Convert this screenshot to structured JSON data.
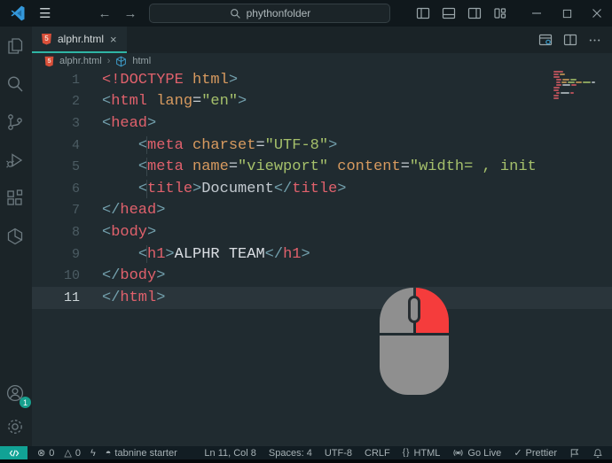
{
  "titlebar": {
    "search_value": "phythonfolder",
    "menu_glyph": "☰",
    "back_glyph": "←",
    "forward_glyph": "→"
  },
  "tab": {
    "label": "alphr.html",
    "close_glyph": "×",
    "file_icon_text": "5"
  },
  "breadcrumb": {
    "file": "alphr.html",
    "separator": "›",
    "symbol": "html"
  },
  "activitybar": {
    "top": [
      "explorer",
      "search",
      "source-control",
      "run-debug",
      "extensions",
      "package"
    ],
    "bottom": [
      "account",
      "settings-gear"
    ],
    "account_badge": "1"
  },
  "editor": {
    "active_line": 11,
    "lines": [
      {
        "num": "1",
        "indent": false,
        "tokens": [
          {
            "t": "<!DOCTYPE",
            "c": "tag"
          },
          {
            "t": " html",
            "c": "attr"
          },
          {
            "t": ">",
            "c": "punct"
          }
        ]
      },
      {
        "num": "2",
        "indent": false,
        "tokens": [
          {
            "t": "<",
            "c": "punct"
          },
          {
            "t": "html",
            "c": "tag"
          },
          {
            "t": " ",
            "c": "plain"
          },
          {
            "t": "lang",
            "c": "attr"
          },
          {
            "t": "=",
            "c": "plain"
          },
          {
            "t": "\"en\"",
            "c": "str"
          },
          {
            "t": ">",
            "c": "punct"
          }
        ]
      },
      {
        "num": "3",
        "indent": false,
        "tokens": [
          {
            "t": "<",
            "c": "punct"
          },
          {
            "t": "head",
            "c": "tag"
          },
          {
            "t": ">",
            "c": "punct"
          }
        ]
      },
      {
        "num": "4",
        "indent": true,
        "tokens": [
          {
            "t": "    ",
            "c": "plain"
          },
          {
            "t": "<",
            "c": "punct"
          },
          {
            "t": "meta",
            "c": "tag"
          },
          {
            "t": " charset",
            "c": "attr"
          },
          {
            "t": "=",
            "c": "plain"
          },
          {
            "t": "\"UTF-8\"",
            "c": "str"
          },
          {
            "t": ">",
            "c": "punct"
          }
        ]
      },
      {
        "num": "5",
        "indent": true,
        "tokens": [
          {
            "t": "    ",
            "c": "plain"
          },
          {
            "t": "<",
            "c": "punct"
          },
          {
            "t": "meta",
            "c": "tag"
          },
          {
            "t": " name",
            "c": "attr"
          },
          {
            "t": "=",
            "c": "plain"
          },
          {
            "t": "\"viewport\"",
            "c": "str"
          },
          {
            "t": " content",
            "c": "attr"
          },
          {
            "t": "=",
            "c": "plain"
          },
          {
            "t": "\"width= , init",
            "c": "str"
          }
        ]
      },
      {
        "num": "6",
        "indent": true,
        "tokens": [
          {
            "t": "    ",
            "c": "plain"
          },
          {
            "t": "<",
            "c": "punct"
          },
          {
            "t": "title",
            "c": "tag"
          },
          {
            "t": ">",
            "c": "punct"
          },
          {
            "t": "Document",
            "c": "plain"
          },
          {
            "t": "</",
            "c": "punct"
          },
          {
            "t": "title",
            "c": "tag"
          },
          {
            "t": ">",
            "c": "punct"
          }
        ]
      },
      {
        "num": "7",
        "indent": false,
        "tokens": [
          {
            "t": "</",
            "c": "punct"
          },
          {
            "t": "head",
            "c": "tag"
          },
          {
            "t": ">",
            "c": "punct"
          }
        ]
      },
      {
        "num": "8",
        "indent": false,
        "tokens": [
          {
            "t": "<",
            "c": "punct"
          },
          {
            "t": "body",
            "c": "tag"
          },
          {
            "t": ">",
            "c": "punct"
          }
        ]
      },
      {
        "num": "9",
        "indent": true,
        "tokens": [
          {
            "t": "    ",
            "c": "plain"
          },
          {
            "t": "<",
            "c": "punct"
          },
          {
            "t": "h1",
            "c": "tag"
          },
          {
            "t": ">",
            "c": "punct"
          },
          {
            "t": "ALPHR TEAM",
            "c": "text"
          },
          {
            "t": "</",
            "c": "punct"
          },
          {
            "t": "h1",
            "c": "tag"
          },
          {
            "t": ">",
            "c": "punct"
          }
        ]
      },
      {
        "num": "10",
        "indent": false,
        "tokens": [
          {
            "t": "</",
            "c": "punct"
          },
          {
            "t": "body",
            "c": "tag"
          },
          {
            "t": ">",
            "c": "punct"
          }
        ]
      },
      {
        "num": "11",
        "indent": false,
        "tokens": [
          {
            "t": "</",
            "c": "punct"
          },
          {
            "t": "html",
            "c": "tag"
          },
          {
            "t": ">",
            "c": "punct"
          }
        ]
      }
    ]
  },
  "minimap": {
    "rows": [
      {
        "indent": 0,
        "segs": [
          {
            "c": "red",
            "w": 11
          }
        ]
      },
      {
        "indent": 0,
        "segs": [
          {
            "c": "red",
            "w": 6
          },
          {
            "c": "orange",
            "w": 6
          }
        ]
      },
      {
        "indent": 0,
        "segs": [
          {
            "c": "red",
            "w": 7
          }
        ]
      },
      {
        "indent": 3,
        "segs": [
          {
            "c": "red",
            "w": 6
          },
          {
            "c": "orange",
            "w": 8
          },
          {
            "c": "green",
            "w": 7
          }
        ]
      },
      {
        "indent": 3,
        "segs": [
          {
            "c": "red",
            "w": 5
          },
          {
            "c": "orange",
            "w": 6
          },
          {
            "c": "green",
            "w": 8
          },
          {
            "c": "orange",
            "w": 7
          },
          {
            "c": "green",
            "w": 9
          },
          {
            "c": "gray",
            "w": 4
          }
        ]
      },
      {
        "indent": 3,
        "segs": [
          {
            "c": "red",
            "w": 6
          },
          {
            "c": "gray",
            "w": 9
          },
          {
            "c": "red",
            "w": 6
          }
        ]
      },
      {
        "indent": 0,
        "segs": [
          {
            "c": "red",
            "w": 7
          }
        ]
      },
      {
        "indent": 0,
        "segs": [
          {
            "c": "red",
            "w": 6
          }
        ]
      },
      {
        "indent": 3,
        "segs": [
          {
            "c": "red",
            "w": 4
          },
          {
            "c": "gray",
            "w": 10
          },
          {
            "c": "red",
            "w": 4
          }
        ]
      },
      {
        "indent": 0,
        "segs": [
          {
            "c": "red",
            "w": 6
          }
        ]
      },
      {
        "indent": 0,
        "segs": [
          {
            "c": "red",
            "w": 6
          }
        ]
      }
    ]
  },
  "statusbar": {
    "left": [
      {
        "name": "errors",
        "glyph": "⊗",
        "label": "0"
      },
      {
        "name": "warnings",
        "glyph": "△",
        "label": "0"
      },
      {
        "name": "thunder-client",
        "glyph": "ϟ",
        "label": ""
      },
      {
        "name": "tabnine",
        "glyph": "◓",
        "label": "tabnine starter"
      }
    ],
    "right": [
      {
        "name": "cursor-position",
        "label": "Ln 11, Col 8"
      },
      {
        "name": "indentation",
        "label": "Spaces: 4"
      },
      {
        "name": "encoding",
        "label": "UTF-8"
      },
      {
        "name": "eol",
        "label": "CRLF"
      },
      {
        "name": "language-mode",
        "glyph": "{}",
        "label": "HTML",
        "braces": true
      },
      {
        "name": "go-live",
        "icon": "broadcast",
        "label": "Go Live"
      },
      {
        "name": "prettier",
        "glyph": "✓",
        "label": "Prettier"
      },
      {
        "name": "feedback",
        "icon": "flag",
        "label": ""
      },
      {
        "name": "notifications",
        "icon": "bell",
        "label": ""
      }
    ]
  },
  "colors": {
    "accent_teal": "#2fb5a5",
    "remote_teal": "#11a295",
    "mouse_red": "#f53c3c",
    "mouse_gray": "#8f8f8f",
    "tag_red": "#e0616c",
    "attr_orange": "#d79a5f",
    "string_green": "#a5c06b",
    "html5_orange": "#d9503a"
  }
}
